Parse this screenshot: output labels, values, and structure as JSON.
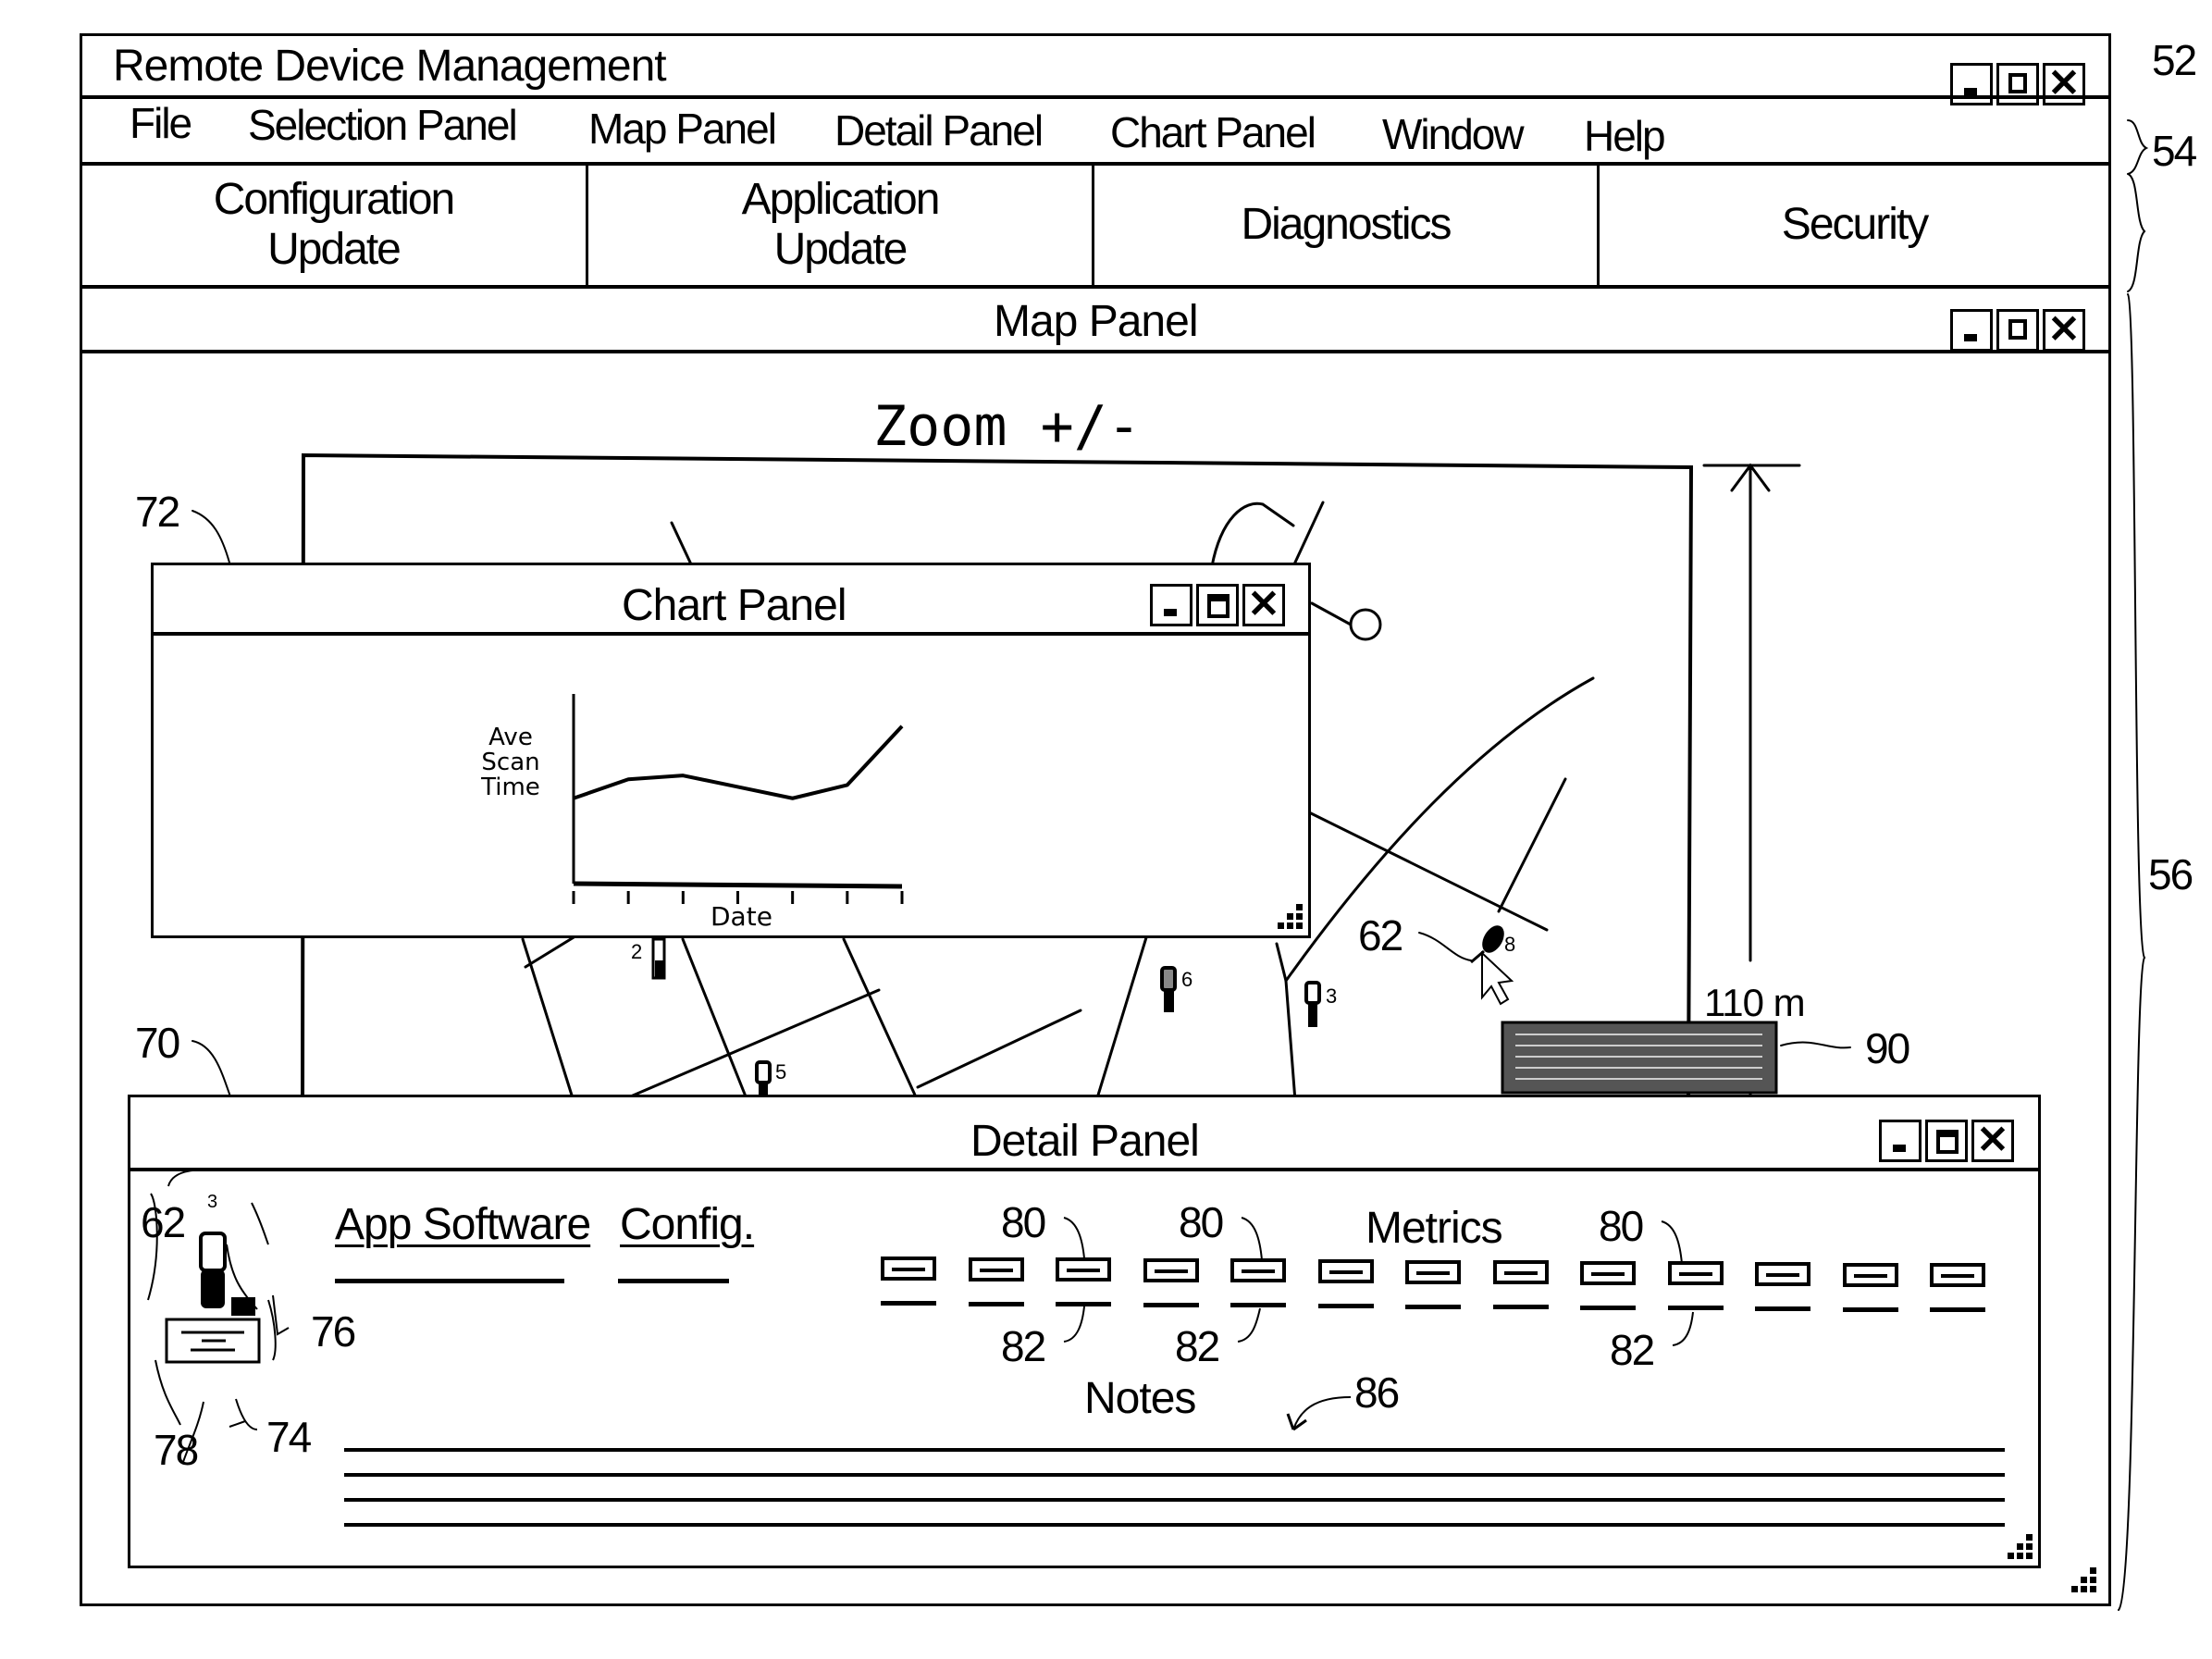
{
  "window": {
    "title": "Remote Device Management",
    "ref_label": "52"
  },
  "menu": {
    "items": [
      "File",
      "Selection Panel",
      "Map Panel",
      "Detail Panel",
      "Chart Panel",
      "Window",
      "Help"
    ],
    "ref_label": "54"
  },
  "toolbar": {
    "buttons": [
      {
        "line1": "Configuration",
        "line2": "Update"
      },
      {
        "line1": "Application",
        "line2": "Update"
      },
      {
        "line1": "Diagnostics",
        "line2": ""
      },
      {
        "line1": "Security",
        "line2": ""
      }
    ]
  },
  "map_panel": {
    "title": "Map Panel",
    "zoom_label": "Zoom +/-",
    "scale_label": "110 m",
    "ref_label": "56",
    "ref_map": "72",
    "ref_map_lower": "70",
    "ref_device": "62",
    "ref_legend": "90",
    "devices": [
      {
        "id": "2"
      },
      {
        "id": "5"
      },
      {
        "id": "6"
      },
      {
        "id": "3"
      },
      {
        "id": "8",
        "selected": true
      }
    ]
  },
  "chart_panel": {
    "title": "Chart Panel"
  },
  "chart_data": {
    "type": "line",
    "title": "",
    "xlabel": "Date",
    "ylabel": "Ave Scan Time",
    "ylabel_lines": [
      "Ave",
      "Scan",
      "Time"
    ],
    "x": [
      1,
      2,
      3,
      4,
      5,
      6,
      7
    ],
    "values": [
      0.45,
      0.55,
      0.57,
      0.51,
      0.45,
      0.52,
      0.83
    ],
    "ylim": [
      0,
      1
    ],
    "grid": false,
    "legend": "none"
  },
  "detail_panel": {
    "title": "Detail Panel",
    "device_number": "3",
    "tabs": [
      "App Software",
      "Config."
    ],
    "metrics_label": "Metrics",
    "metrics_count": 13,
    "notes_label": "Notes",
    "notes_line_count": 4,
    "ref_labels": {
      "device": "62",
      "dock": "76",
      "info": "78",
      "panel": "74",
      "metric": "80",
      "metric_value": "82",
      "notes": "86"
    }
  }
}
